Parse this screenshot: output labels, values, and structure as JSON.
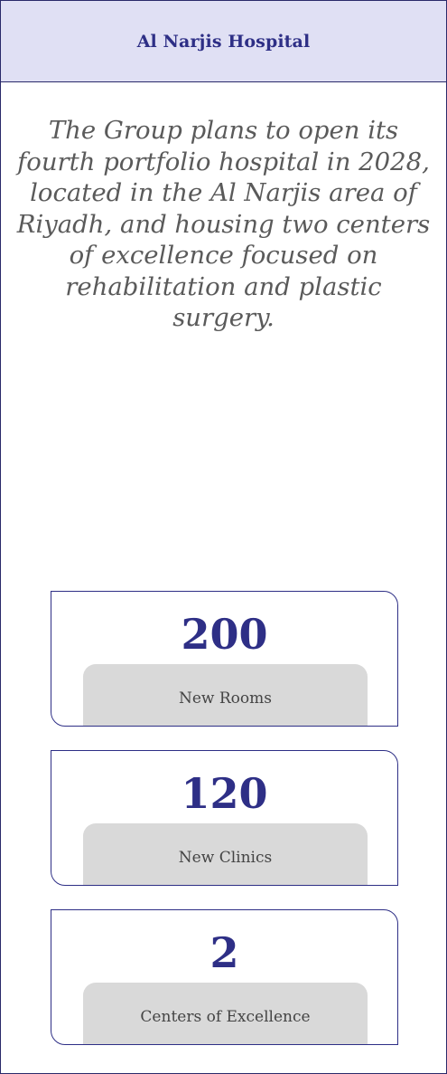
{
  "header": {
    "title": "Al Narjis Hospital"
  },
  "main": {
    "description": "The Group plans to open its fourth portfolio hospital in 2028, located in the Al Narjis area of Riyadh, and housing two centers of excellence focused on rehabilitation and plastic surgery."
  },
  "stats": [
    {
      "value": "200",
      "label": "New Rooms"
    },
    {
      "value": "120",
      "label": "New Clinics"
    },
    {
      "value": "2",
      "label": "Centers of Excellence"
    }
  ],
  "colors": {
    "accent": "#2e2f86",
    "header_bg": "#e0e0f4",
    "label_bg": "#d9d9d9",
    "body_text": "#5a5a5a"
  }
}
